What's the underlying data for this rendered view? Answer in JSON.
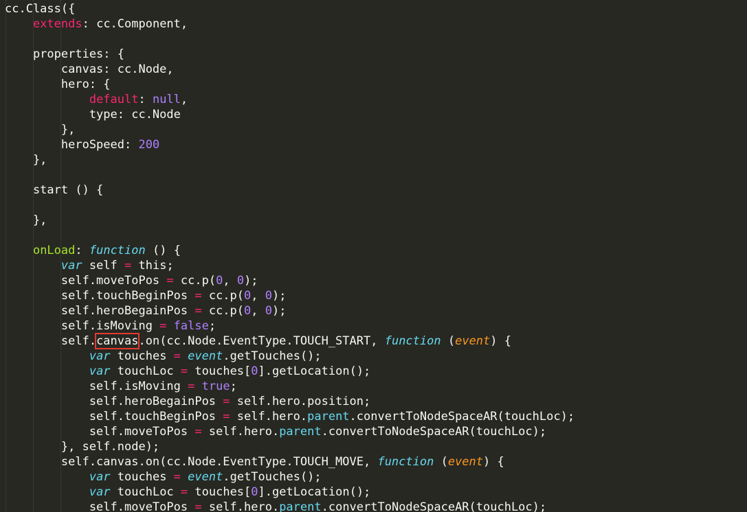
{
  "editor": {
    "theme_colors": {
      "background": "#272822",
      "text": "#f8f8f2",
      "keyword": "#f92672",
      "function_keyword": "#66d9ef",
      "number": "#ae81ff",
      "param": "#fd971f",
      "property_name": "#a6e22e",
      "highlight_box": "#e8392f"
    },
    "highlighted_token": "canvas",
    "lines": [
      [
        {
          "t": "cc.Class({",
          "c": "t"
        }
      ],
      [
        {
          "t": "    ",
          "c": "t"
        },
        {
          "t": "extends",
          "c": "k"
        },
        {
          "t": ": cc.Component,",
          "c": "t"
        }
      ],
      [],
      [
        {
          "t": "    properties: {",
          "c": "t"
        }
      ],
      [
        {
          "t": "        canvas: cc.Node,",
          "c": "t"
        }
      ],
      [
        {
          "t": "        hero: {",
          "c": "t"
        }
      ],
      [
        {
          "t": "            ",
          "c": "t"
        },
        {
          "t": "default",
          "c": "k"
        },
        {
          "t": ": ",
          "c": "t"
        },
        {
          "t": "null",
          "c": "s"
        },
        {
          "t": ",",
          "c": "t"
        }
      ],
      [
        {
          "t": "            type: cc.Node",
          "c": "t"
        }
      ],
      [
        {
          "t": "        },",
          "c": "t"
        }
      ],
      [
        {
          "t": "        heroSpeed: ",
          "c": "t"
        },
        {
          "t": "200",
          "c": "n"
        }
      ],
      [
        {
          "t": "    },",
          "c": "t"
        }
      ],
      [],
      [
        {
          "t": "    start () {",
          "c": "t"
        }
      ],
      [],
      [
        {
          "t": "    },",
          "c": "t"
        }
      ],
      [],
      [
        {
          "t": "    ",
          "c": "t"
        },
        {
          "t": "onLoad",
          "c": "g"
        },
        {
          "t": ": ",
          "c": "t"
        },
        {
          "t": "function",
          "c": "f"
        },
        {
          "t": " () {",
          "c": "t"
        }
      ],
      [
        {
          "t": "        ",
          "c": "t"
        },
        {
          "t": "var",
          "c": "f"
        },
        {
          "t": " self ",
          "c": "t"
        },
        {
          "t": "=",
          "c": "k"
        },
        {
          "t": " this;",
          "c": "t"
        }
      ],
      [
        {
          "t": "        self.moveToPos ",
          "c": "t"
        },
        {
          "t": "=",
          "c": "k"
        },
        {
          "t": " cc.p(",
          "c": "t"
        },
        {
          "t": "0",
          "c": "n"
        },
        {
          "t": ", ",
          "c": "t"
        },
        {
          "t": "0",
          "c": "n"
        },
        {
          "t": ");",
          "c": "t"
        }
      ],
      [
        {
          "t": "        self.touchBeginPos ",
          "c": "t"
        },
        {
          "t": "=",
          "c": "k"
        },
        {
          "t": " cc.p(",
          "c": "t"
        },
        {
          "t": "0",
          "c": "n"
        },
        {
          "t": ", ",
          "c": "t"
        },
        {
          "t": "0",
          "c": "n"
        },
        {
          "t": ");",
          "c": "t"
        }
      ],
      [
        {
          "t": "        self.heroBegainPos ",
          "c": "t"
        },
        {
          "t": "=",
          "c": "k"
        },
        {
          "t": " cc.p(",
          "c": "t"
        },
        {
          "t": "0",
          "c": "n"
        },
        {
          "t": ", ",
          "c": "t"
        },
        {
          "t": "0",
          "c": "n"
        },
        {
          "t": ");",
          "c": "t"
        }
      ],
      [
        {
          "t": "        self.isMoving ",
          "c": "t"
        },
        {
          "t": "=",
          "c": "k"
        },
        {
          "t": " ",
          "c": "t"
        },
        {
          "t": "false",
          "c": "s"
        },
        {
          "t": ";",
          "c": "t"
        }
      ],
      [
        {
          "t": "        self.",
          "c": "t"
        },
        {
          "t": "canvas",
          "c": "t",
          "hl": true
        },
        {
          "t": ".on(cc.Node.EventType.TOUCH_START, ",
          "c": "t"
        },
        {
          "t": "function",
          "c": "f"
        },
        {
          "t": " (",
          "c": "t"
        },
        {
          "t": "event",
          "c": "p"
        },
        {
          "t": ") {",
          "c": "t"
        }
      ],
      [
        {
          "t": "            ",
          "c": "t"
        },
        {
          "t": "var",
          "c": "f"
        },
        {
          "t": " touches ",
          "c": "t"
        },
        {
          "t": "=",
          "c": "k"
        },
        {
          "t": " ",
          "c": "t"
        },
        {
          "t": "event",
          "c": "f"
        },
        {
          "t": ".getTouches();",
          "c": "t"
        }
      ],
      [
        {
          "t": "            ",
          "c": "t"
        },
        {
          "t": "var",
          "c": "f"
        },
        {
          "t": " touchLoc ",
          "c": "t"
        },
        {
          "t": "=",
          "c": "k"
        },
        {
          "t": " touches[",
          "c": "t"
        },
        {
          "t": "0",
          "c": "n"
        },
        {
          "t": "].getLocation();",
          "c": "t"
        }
      ],
      [
        {
          "t": "            self.isMoving ",
          "c": "t"
        },
        {
          "t": "=",
          "c": "k"
        },
        {
          "t": " ",
          "c": "t"
        },
        {
          "t": "true",
          "c": "s"
        },
        {
          "t": ";",
          "c": "t"
        }
      ],
      [
        {
          "t": "            self.heroBegainPos ",
          "c": "t"
        },
        {
          "t": "=",
          "c": "k"
        },
        {
          "t": " self.hero.position;",
          "c": "t"
        }
      ],
      [
        {
          "t": "            self.touchBeginPos ",
          "c": "t"
        },
        {
          "t": "=",
          "c": "k"
        },
        {
          "t": " self.hero.",
          "c": "t"
        },
        {
          "t": "parent",
          "c": "b"
        },
        {
          "t": ".convertToNodeSpaceAR(touchLoc);",
          "c": "t"
        }
      ],
      [
        {
          "t": "            self.moveToPos ",
          "c": "t"
        },
        {
          "t": "=",
          "c": "k"
        },
        {
          "t": " self.hero.",
          "c": "t"
        },
        {
          "t": "parent",
          "c": "b"
        },
        {
          "t": ".convertToNodeSpaceAR(touchLoc);",
          "c": "t"
        }
      ],
      [
        {
          "t": "        }, self.node);",
          "c": "t"
        }
      ],
      [
        {
          "t": "        self.canvas.on(cc.Node.EventType.TOUCH_MOVE, ",
          "c": "t"
        },
        {
          "t": "function",
          "c": "f"
        },
        {
          "t": " (",
          "c": "t"
        },
        {
          "t": "event",
          "c": "p"
        },
        {
          "t": ") {",
          "c": "t"
        }
      ],
      [
        {
          "t": "            ",
          "c": "t"
        },
        {
          "t": "var",
          "c": "f"
        },
        {
          "t": " touches ",
          "c": "t"
        },
        {
          "t": "=",
          "c": "k"
        },
        {
          "t": " ",
          "c": "t"
        },
        {
          "t": "event",
          "c": "f"
        },
        {
          "t": ".getTouches();",
          "c": "t"
        }
      ],
      [
        {
          "t": "            ",
          "c": "t"
        },
        {
          "t": "var",
          "c": "f"
        },
        {
          "t": " touchLoc ",
          "c": "t"
        },
        {
          "t": "=",
          "c": "k"
        },
        {
          "t": " touches[",
          "c": "t"
        },
        {
          "t": "0",
          "c": "n"
        },
        {
          "t": "].getLocation();",
          "c": "t"
        }
      ],
      [
        {
          "t": "            self.moveToPos ",
          "c": "t"
        },
        {
          "t": "=",
          "c": "k"
        },
        {
          "t": " self.hero.",
          "c": "t"
        },
        {
          "t": "parent",
          "c": "b"
        },
        {
          "t": ".convertToNodeSpaceAR(touchLoc);",
          "c": "t"
        }
      ]
    ]
  }
}
